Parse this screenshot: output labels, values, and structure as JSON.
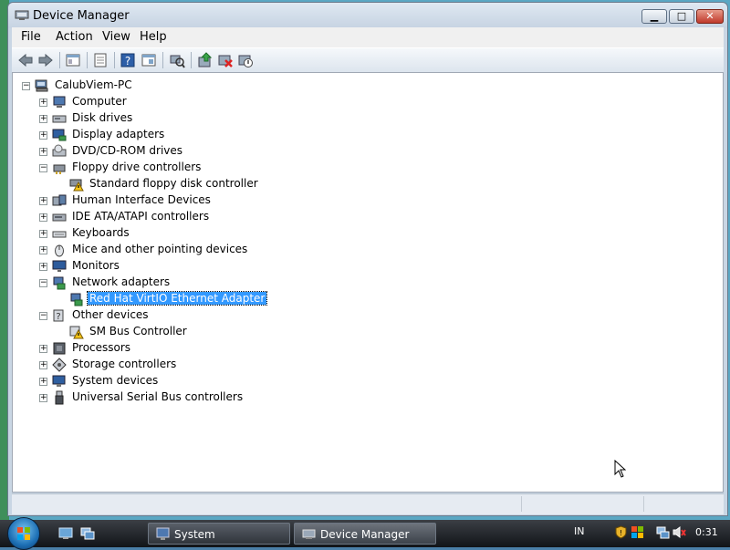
{
  "window": {
    "title": "Device Manager"
  },
  "menu": [
    "File",
    "Action",
    "View",
    "Help"
  ],
  "toolbar_icons": [
    "back-icon",
    "forward-icon",
    "up-level-icon",
    "properties-icon",
    "help-icon",
    "view-icon",
    "scan-hardware-icon",
    "update-driver-icon",
    "uninstall-icon",
    "disable-icon"
  ],
  "tree": {
    "root": "CalubViem-PC",
    "items": [
      {
        "label": "Computer",
        "expanded": false
      },
      {
        "label": "Disk drives",
        "expanded": false
      },
      {
        "label": "Display adapters",
        "expanded": false
      },
      {
        "label": "DVD/CD-ROM drives",
        "expanded": false
      },
      {
        "label": "Floppy drive controllers",
        "expanded": true,
        "children": [
          {
            "label": "Standard floppy disk controller",
            "warning": true
          }
        ]
      },
      {
        "label": "Human Interface Devices",
        "expanded": false
      },
      {
        "label": "IDE ATA/ATAPI controllers",
        "expanded": false
      },
      {
        "label": "Keyboards",
        "expanded": false
      },
      {
        "label": "Mice and other pointing devices",
        "expanded": false
      },
      {
        "label": "Monitors",
        "expanded": false
      },
      {
        "label": "Network adapters",
        "expanded": true,
        "children": [
          {
            "label": "Red Hat VirtIO Ethernet Adapter",
            "selected": true
          }
        ]
      },
      {
        "label": "Other devices",
        "expanded": true,
        "children": [
          {
            "label": "SM Bus Controller",
            "warning": true
          }
        ]
      },
      {
        "label": "Processors",
        "expanded": false
      },
      {
        "label": "Storage controllers",
        "expanded": false
      },
      {
        "label": "System devices",
        "expanded": false
      },
      {
        "label": "Universal Serial Bus controllers",
        "expanded": false
      }
    ]
  },
  "taskbar": {
    "buttons": [
      {
        "label": "System"
      },
      {
        "label": "Device Manager"
      }
    ],
    "language": "IN",
    "clock": "0:31"
  },
  "colors": {
    "selection": "#3399ff",
    "window_frame": "#c9d6e4",
    "taskbar": "#1a1d22"
  }
}
